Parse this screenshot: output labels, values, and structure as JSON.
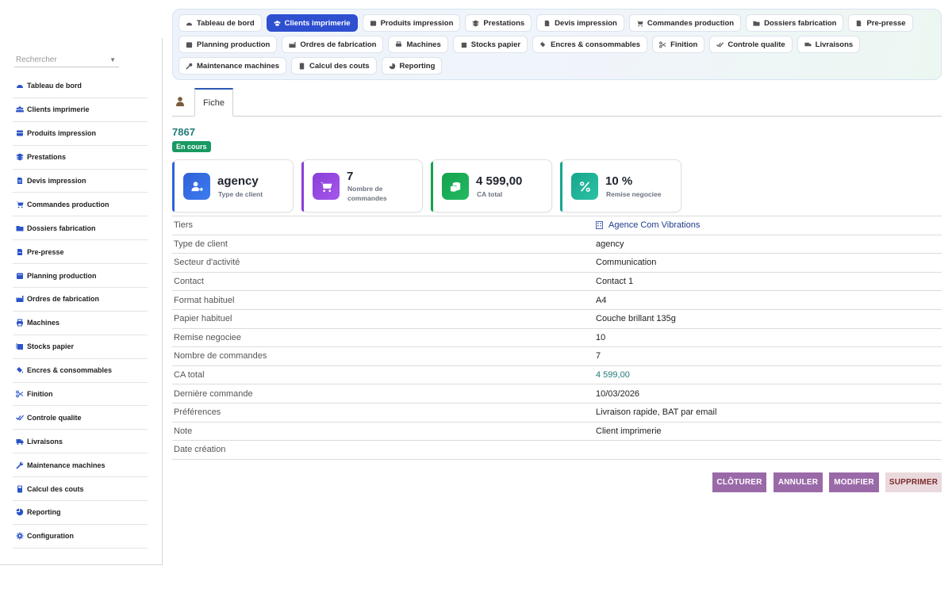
{
  "sidebar": {
    "search_placeholder": "Rechercher",
    "items": [
      {
        "label": "Tableau de bord",
        "icon": "dashboard-icon"
      },
      {
        "label": "Clients imprimerie",
        "icon": "users-icon"
      },
      {
        "label": "Produits impression",
        "icon": "box-icon"
      },
      {
        "label": "Prestations",
        "icon": "layers-icon"
      },
      {
        "label": "Devis impression",
        "icon": "file-icon"
      },
      {
        "label": "Commandes production",
        "icon": "cart-icon"
      },
      {
        "label": "Dossiers fabrication",
        "icon": "folder-icon"
      },
      {
        "label": "Pre-presse",
        "icon": "document-icon"
      },
      {
        "label": "Planning production",
        "icon": "calendar-icon"
      },
      {
        "label": "Ordres de fabrication",
        "icon": "factory-icon"
      },
      {
        "label": "Machines",
        "icon": "printer-icon"
      },
      {
        "label": "Stocks papier",
        "icon": "paper-stack-icon"
      },
      {
        "label": "Encres & consommables",
        "icon": "ink-icon"
      },
      {
        "label": "Finition",
        "icon": "scissors-icon"
      },
      {
        "label": "Controle qualite",
        "icon": "check-double-icon"
      },
      {
        "label": "Livraisons",
        "icon": "truck-icon"
      },
      {
        "label": "Maintenance machines",
        "icon": "wrench-icon"
      },
      {
        "label": "Calcul des couts",
        "icon": "calculator-icon"
      },
      {
        "label": "Reporting",
        "icon": "pie-chart-icon"
      },
      {
        "label": "Configuration",
        "icon": "gear-icon"
      }
    ]
  },
  "topnav": {
    "active": "Clients imprimerie",
    "items": [
      "Tableau de bord",
      "Clients imprimerie",
      "Produits impression",
      "Prestations",
      "Devis impression",
      "Commandes production",
      "Dossiers fabrication",
      "Pre-presse",
      "Planning production",
      "Ordres de fabrication",
      "Machines",
      "Stocks papier",
      "Encres & consommables",
      "Finition",
      "Controle qualite",
      "Livraisons",
      "Maintenance machines",
      "Calcul des couts",
      "Reporting"
    ]
  },
  "tabs": {
    "fiche": "Fiche"
  },
  "record": {
    "ref": "7867",
    "status": "En cours"
  },
  "kpis": [
    {
      "value": "agency",
      "label": "Type de client",
      "color": "#2f62d6",
      "icon": "user-arrow-icon"
    },
    {
      "value": "7",
      "label": "Nombre de commandes",
      "color": "#8a3fd6",
      "icon": "cart-icon"
    },
    {
      "value": "4 599,00",
      "label": "CA total",
      "color": "#15a24d",
      "icon": "coins-icon"
    },
    {
      "value": "10 %",
      "label": "Remise negociee",
      "color": "#17a58b",
      "icon": "percent-icon"
    }
  ],
  "details": [
    {
      "key": "Tiers",
      "value": "Agence Com Vibrations"
    },
    {
      "key": "Type de client",
      "value": "agency"
    },
    {
      "key": "Secteur d'activité",
      "value": "Communication"
    },
    {
      "key": "Contact",
      "value": "Contact 1"
    },
    {
      "key": "Format habituel",
      "value": "A4"
    },
    {
      "key": "Papier habituel",
      "value": "Couche brillant 135g"
    },
    {
      "key": "Remise negociee",
      "value": "10"
    },
    {
      "key": "Nombre de commandes",
      "value": "7"
    },
    {
      "key": "CA total",
      "value": "4 599,00"
    },
    {
      "key": "Dernière commande",
      "value": "10/03/2026"
    },
    {
      "key": "Préférences",
      "value": "Livraison rapide, BAT par email"
    },
    {
      "key": "Note",
      "value": "Client imprimerie"
    },
    {
      "key": "Date création",
      "value": ""
    }
  ],
  "actions": {
    "close": "CLÔTURER",
    "cancel": "ANNULER",
    "modify": "MODIFIER",
    "delete": "SUPPRIMER"
  }
}
